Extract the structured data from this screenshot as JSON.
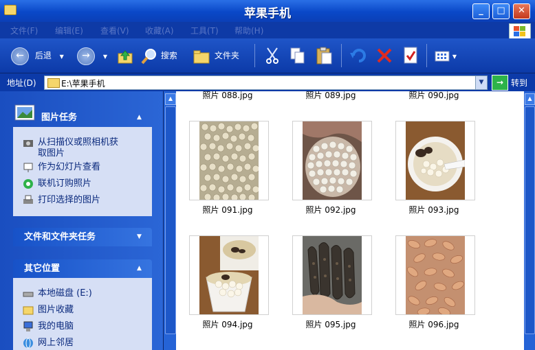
{
  "window": {
    "title": "苹果手机"
  },
  "menu": [
    "文件(F)",
    "编辑(E)",
    "查看(V)",
    "收藏(A)",
    "工具(T)",
    "帮助(H)"
  ],
  "toolbar": {
    "back": "后退",
    "search": "搜索",
    "folders": "文件夹"
  },
  "address": {
    "label": "地址(D)",
    "path": "E:\\苹果手机",
    "go": "转到"
  },
  "tasks": {
    "picture": {
      "title": "图片任务",
      "items": [
        "从扫描仪或照相机获",
        "取图片",
        "作为幻灯片查看",
        "联机订购照片",
        "打印选择的图片"
      ]
    },
    "file_folder": {
      "title": "文件和文件夹任务"
    },
    "other": {
      "title": "其它位置",
      "items": [
        "本地磁盘 (E:)",
        "图片收藏",
        "我的电脑",
        "网上邻居"
      ]
    }
  },
  "files": {
    "top_row": [
      "照片 088.jpg",
      "照片 089.jpg",
      "照片 090.jpg"
    ],
    "row1": [
      "照片 091.jpg",
      "照片 092.jpg",
      "照片 093.jpg"
    ],
    "row2": [
      "照片 094.jpg",
      "照片 095.jpg",
      "照片 096.jpg"
    ]
  }
}
